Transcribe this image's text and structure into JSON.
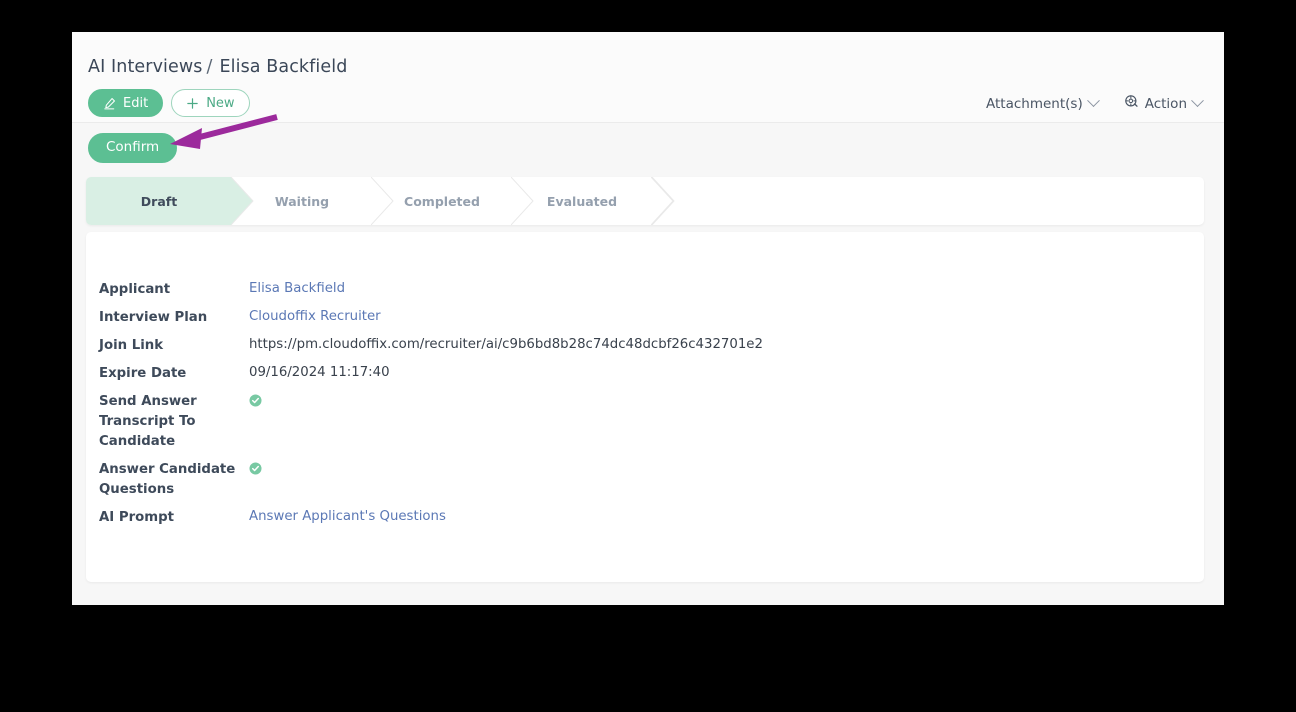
{
  "header": {
    "breadcrumb_parent": "AI Interviews",
    "breadcrumb_separator": "/",
    "breadcrumb_current": "Elisa Backfield",
    "edit_label": "Edit",
    "new_label": "New",
    "attachments_label": "Attachment(s)",
    "action_label": "Action",
    "icons": {
      "edit": "pencil-icon",
      "new": "plus-icon",
      "attachments_caret": "chevron-down-icon",
      "action": "action-gear-icon",
      "action_caret": "chevron-down-icon"
    }
  },
  "action_row": {
    "confirm_label": "Confirm"
  },
  "statusbar": {
    "stages": [
      {
        "label": "Draft",
        "active": true
      },
      {
        "label": "Waiting",
        "active": false
      },
      {
        "label": "Completed",
        "active": false
      },
      {
        "label": "Evaluated",
        "active": false
      }
    ]
  },
  "form": {
    "fields": [
      {
        "label": "Applicant",
        "value": "Elisa Backfield",
        "type": "link"
      },
      {
        "label": "Interview Plan",
        "value": "Cloudoffix Recruiter",
        "type": "link"
      },
      {
        "label": "Join Link",
        "value": "https://pm.cloudoffix.com/recruiter/ai/c9b6bd8b28c74dc48dcbf26c432701e2",
        "type": "text"
      },
      {
        "label": "Expire Date",
        "value": "09/16/2024 11:17:40",
        "type": "text"
      },
      {
        "label": "Send Answer Transcript To Candidate",
        "value": "",
        "type": "checkmark"
      },
      {
        "label": "Answer Candidate Questions",
        "value": "",
        "type": "checkmark"
      },
      {
        "label": "AI Prompt",
        "value": "Answer Applicant's Questions",
        "type": "link"
      }
    ]
  },
  "annotation": {
    "arrow_color": "#9c2a9c",
    "arrow_name": "confirm-button-pointer-arrow"
  },
  "colors": {
    "accent_green": "#5cbf93",
    "stage_active_bg": "#d9efe4",
    "link_blue": "#5b78b5",
    "page_bg": "#f7f7f7"
  }
}
